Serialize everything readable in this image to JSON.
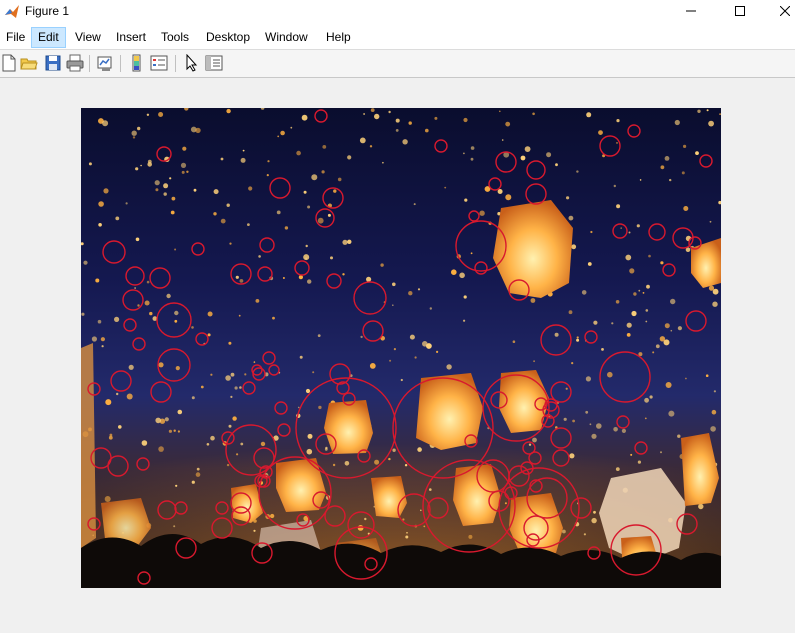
{
  "window": {
    "title": "Figure 1",
    "app_icon": "matlab-icon",
    "controls": [
      "minimize-icon",
      "maximize-icon",
      "close-icon"
    ]
  },
  "menubar": {
    "items": [
      "File",
      "Edit",
      "View",
      "Insert",
      "Tools",
      "Desktop",
      "Window",
      "Help"
    ],
    "active": "Edit"
  },
  "toolbar": {
    "buttons": [
      "new-figure-icon",
      "open-file-icon",
      "save-icon",
      "print-icon",
      "link-plot-icon",
      "colorbar-icon",
      "legend-icon",
      "edit-plot-icon",
      "property-inspector-icon"
    ]
  },
  "figure": {
    "image_description_icon": "image-display",
    "detected_circle_color": "#d8192e"
  },
  "colors": {
    "titlebar_bg": "#ffffff",
    "menu_active_bg": "#cce8ff",
    "figure_bg": "#f0f0f0",
    "circle": "#d8192e"
  }
}
